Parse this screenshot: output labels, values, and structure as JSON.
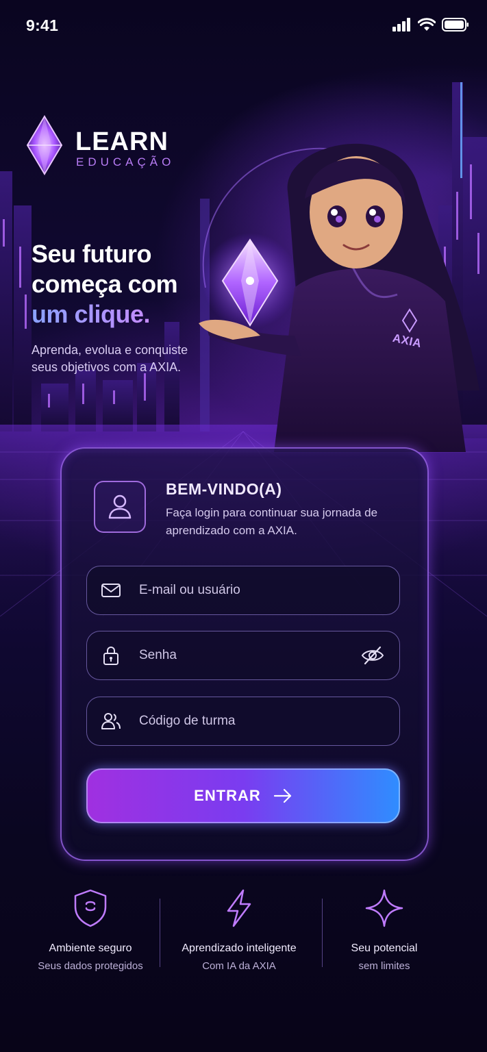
{
  "status_bar": {
    "time": "9:41"
  },
  "brand": {
    "name": "LEARN",
    "tagline": "EDUCAÇÃO"
  },
  "hero": {
    "line1": "Seu futuro",
    "line2": "começa com",
    "line3": "um clique.",
    "subtitle": "Aprenda, evolua e conquiste seus objetivos com a AXIA.",
    "sleeve_badge": "AXIA"
  },
  "login_card": {
    "title": "BEM-VINDO(A)",
    "subtitle": "Faça login para continuar sua jornada de aprendizado com a AXIA.",
    "email_placeholder": "E-mail ou usuário",
    "password_placeholder": "Senha",
    "class_code_placeholder": "Código de turma",
    "submit_label": "ENTRAR"
  },
  "features": [
    {
      "title": "Ambiente seguro",
      "subtitle": "Seus dados protegidos",
      "icon": "shield-icon"
    },
    {
      "title": "Aprendizado inteligente",
      "subtitle": "Com IA da AXIA",
      "icon": "lightning-icon"
    },
    {
      "title": "Seu potencial",
      "subtitle": "sem limites",
      "icon": "sparkle-icon"
    }
  ],
  "colors": {
    "background": "#0b0620",
    "accent_purple": "#b87cf5",
    "button_start": "#a030e0",
    "button_end": "#2f8dff"
  }
}
